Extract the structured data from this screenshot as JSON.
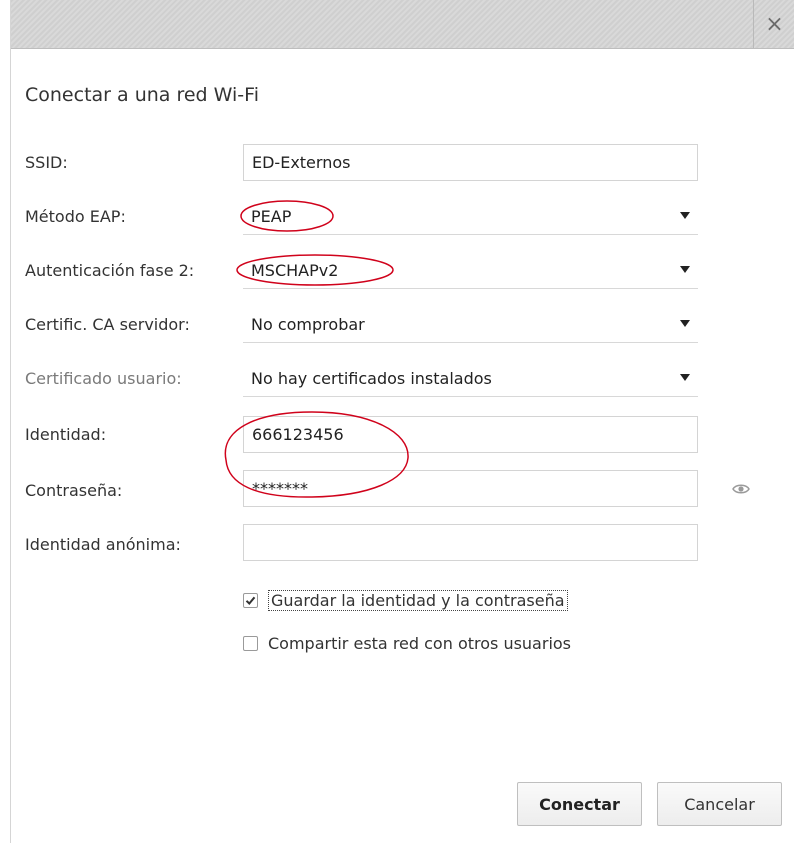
{
  "window": {
    "close_icon": "close-icon",
    "close_glyph": "×"
  },
  "heading": "Conectar a una red Wi-Fi",
  "fields": {
    "ssid": {
      "label": "SSID:",
      "value": "ED-Externos"
    },
    "eap_method": {
      "label": "Método EAP:",
      "value": "PEAP"
    },
    "phase2_auth": {
      "label": "Autenticación fase 2:",
      "value": "MSCHAPv2"
    },
    "ca_cert": {
      "label": "Certific. CA servidor:",
      "value": "No comprobar"
    },
    "user_cert": {
      "label": "Certificado usuario:",
      "value": "No hay certificados instalados"
    },
    "identity": {
      "label": "Identidad:",
      "value": "666123456"
    },
    "password": {
      "label": "Contraseña:",
      "value": "*******"
    },
    "anon_identity": {
      "label": "Identidad anónima:",
      "value": ""
    }
  },
  "options": {
    "save_credentials": {
      "label": "Guardar la identidad y la contraseña",
      "checked": true
    },
    "share_network": {
      "label": "Compartir esta red con otros usuarios",
      "checked": false
    }
  },
  "buttons": {
    "connect": "Conectar",
    "cancel": "Cancelar"
  },
  "colors": {
    "annotation": "#d0021b",
    "titlebar": "#d4d4d4"
  }
}
